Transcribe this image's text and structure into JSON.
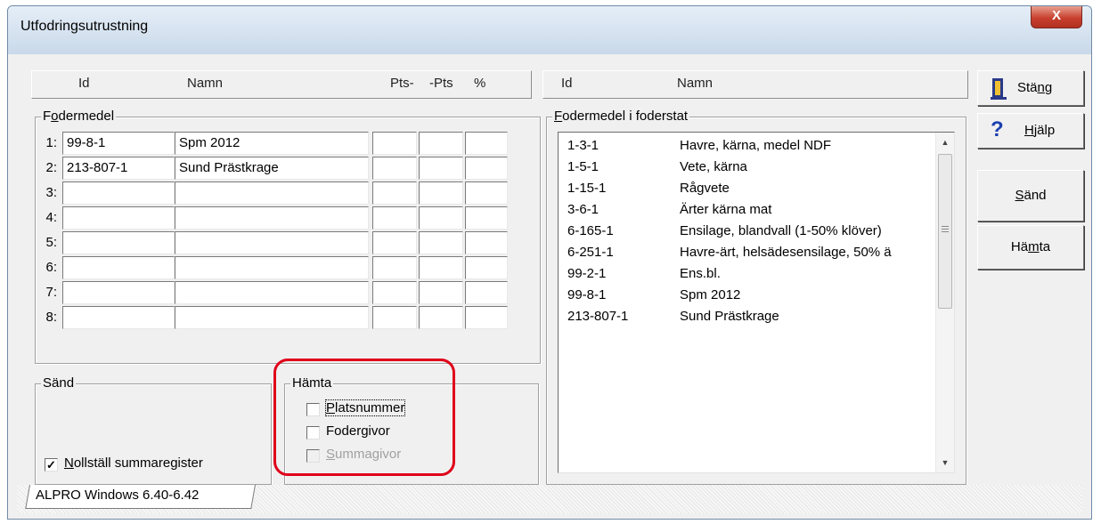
{
  "window": {
    "title": "Utfodringsutrustning",
    "close_glyph": "X"
  },
  "left_header": {
    "id": "Id",
    "name": "Namn",
    "pts_minus": "Pts-",
    "minus_pts": "-Pts",
    "pct": "%"
  },
  "right_header": {
    "id": "Id",
    "name": "Namn"
  },
  "fodermedel_group": {
    "title": "Fodermedel",
    "title_mnemonic": "o",
    "rows": [
      {
        "num": "1:",
        "id": "99-8-1",
        "name": "Spm 2012"
      },
      {
        "num": "2:",
        "id": "213-807-1",
        "name": "Sund Prästkrage"
      },
      {
        "num": "3:",
        "id": "",
        "name": ""
      },
      {
        "num": "4:",
        "id": "",
        "name": ""
      },
      {
        "num": "5:",
        "id": "",
        "name": ""
      },
      {
        "num": "6:",
        "id": "",
        "name": ""
      },
      {
        "num": "7:",
        "id": "",
        "name": ""
      },
      {
        "num": "8:",
        "id": "",
        "name": ""
      }
    ]
  },
  "foderstat_group": {
    "title": "Fodermedel i foderstat",
    "items": [
      {
        "id": "1-3-1",
        "name": "Havre, kärna, medel NDF"
      },
      {
        "id": "1-5-1",
        "name": "Vete, kärna"
      },
      {
        "id": "1-15-1",
        "name": "Rågvete"
      },
      {
        "id": "3-6-1",
        "name": "Ärter kärna mat"
      },
      {
        "id": "6-165-1",
        "name": "Ensilage, blandvall (1-50% klöver)"
      },
      {
        "id": "6-251-1",
        "name": "Havre-ärt, helsädesensilage, 50% ä"
      },
      {
        "id": "99-2-1",
        "name": "Ens.bl."
      },
      {
        "id": "99-8-1",
        "name": "Spm 2012"
      },
      {
        "id": "213-807-1",
        "name": "Sund Prästkrage"
      }
    ]
  },
  "sand_group": {
    "title": "Sänd",
    "checkbox": {
      "label": "Nollställ summaregister",
      "checked": true
    }
  },
  "hamta_group": {
    "title": "Hämta",
    "checkboxes": [
      {
        "label": "Platsnummer",
        "checked": false,
        "enabled": true,
        "focused": true
      },
      {
        "label": "Fodergivor",
        "checked": false,
        "enabled": true
      },
      {
        "label": "Summagivor",
        "checked": false,
        "enabled": false
      }
    ]
  },
  "buttons": {
    "stang": "Stäng",
    "hjalp": "Hjälp",
    "sand": "Sänd",
    "hamta": "Hämta"
  },
  "status_tab": "ALPRO Windows 6.40-6.42",
  "colors": {
    "highlight": "#e0001a",
    "help_icon": "#1a3fb0",
    "close_button": "#c8402e"
  },
  "icons": {
    "stang": "door-exit-icon",
    "hjalp": "question-mark-icon"
  }
}
